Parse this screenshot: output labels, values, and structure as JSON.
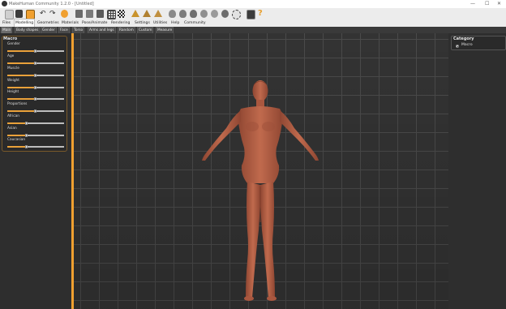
{
  "window": {
    "title": "MakeHuman Community 1.2.0 - [Untitled]",
    "minimize": "—",
    "maximize": "☐",
    "close": "✕"
  },
  "toolbar": {
    "icons": [
      "undo-icon",
      "redo-icon",
      "reset-icon",
      "smooth-icon",
      "wireframe-icon",
      "background-icon",
      "grid-icon",
      "checker-icon",
      "front-view-icon",
      "back-view-icon",
      "left-view-icon",
      "right-view-icon",
      "top-view-icon",
      "bottom-view-icon",
      "reset-camera-icon",
      "screenshot-icon",
      "help-icon"
    ],
    "accent": "#f0a030"
  },
  "menu": [
    "Files",
    "Modelling",
    "Geometries",
    "Materials",
    "Pose/Animate",
    "Rendering",
    "Settings",
    "Utilities",
    "Help",
    "Community"
  ],
  "menu_active": "Modelling",
  "subtabs": [
    "Main",
    "Body shapes",
    "Gender",
    "Face",
    "Torso",
    "Arms and legs",
    "Random",
    "Custom",
    "Measure"
  ],
  "subtab_active": "Main",
  "macro": {
    "title": "Macro",
    "sliders": [
      {
        "label": "Gender",
        "value": 0.5
      },
      {
        "label": "Age",
        "value": 0.5
      },
      {
        "label": "Muscle",
        "value": 0.5
      },
      {
        "label": "Weight",
        "value": 0.5
      },
      {
        "label": "Height",
        "value": 0.5
      },
      {
        "label": "Proportions",
        "value": 0.5
      },
      {
        "label": "African",
        "value": 0.33
      },
      {
        "label": "Asian",
        "value": 0.33
      },
      {
        "label": "Caucasian",
        "value": 0.33
      }
    ]
  },
  "category": {
    "title": "Category",
    "item": "Macro"
  },
  "colors": {
    "skin": "#b8654a",
    "accent": "#f0a030",
    "panel": "#2e2e2e",
    "grid": "#4a4a4a"
  }
}
